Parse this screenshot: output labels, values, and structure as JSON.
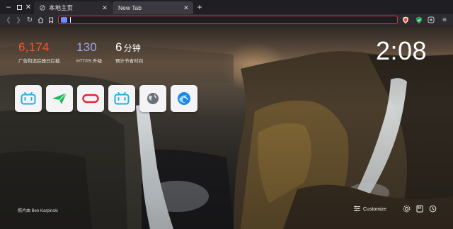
{
  "tabs": [
    {
      "title": "本地主页",
      "active": false
    },
    {
      "title": "New Tab",
      "active": true
    }
  ],
  "toolbar": {
    "url": "",
    "icons": [
      "back-icon",
      "forward-icon",
      "reload-icon",
      "home-icon",
      "bookmark-icon",
      "brave-shields-icon",
      "brave-rewards-icon",
      "menu-icon"
    ]
  },
  "stats": [
    {
      "value": "6,174",
      "unit": "",
      "label": "广告和追踪器已拦截",
      "color": "#fb542b"
    },
    {
      "value": "130",
      "unit": "",
      "label": "HTTPS 升级",
      "color": "#a0a5eb"
    },
    {
      "value": "6",
      "unit": "分钟",
      "label": "预计节省时间",
      "color": "#ffffff"
    }
  ],
  "clock": "2:08",
  "top_sites": [
    {
      "name": "bilibili",
      "icon": "bilibili-icon"
    },
    {
      "name": "send",
      "icon": "send-arrow-icon"
    },
    {
      "name": "oppo",
      "icon": "oppo-icon"
    },
    {
      "name": "bilibili",
      "icon": "bilibili-icon"
    },
    {
      "name": "globe",
      "icon": "globe-icon"
    },
    {
      "name": "qq-browser",
      "icon": "swirl-icon"
    }
  ],
  "photo_credit": "照片由 Ben Karpinski",
  "customize_label": "Customize",
  "colors": {
    "accent": "#fb542b",
    "https": "#a0a5eb",
    "urlbar_border": "#c04040"
  }
}
